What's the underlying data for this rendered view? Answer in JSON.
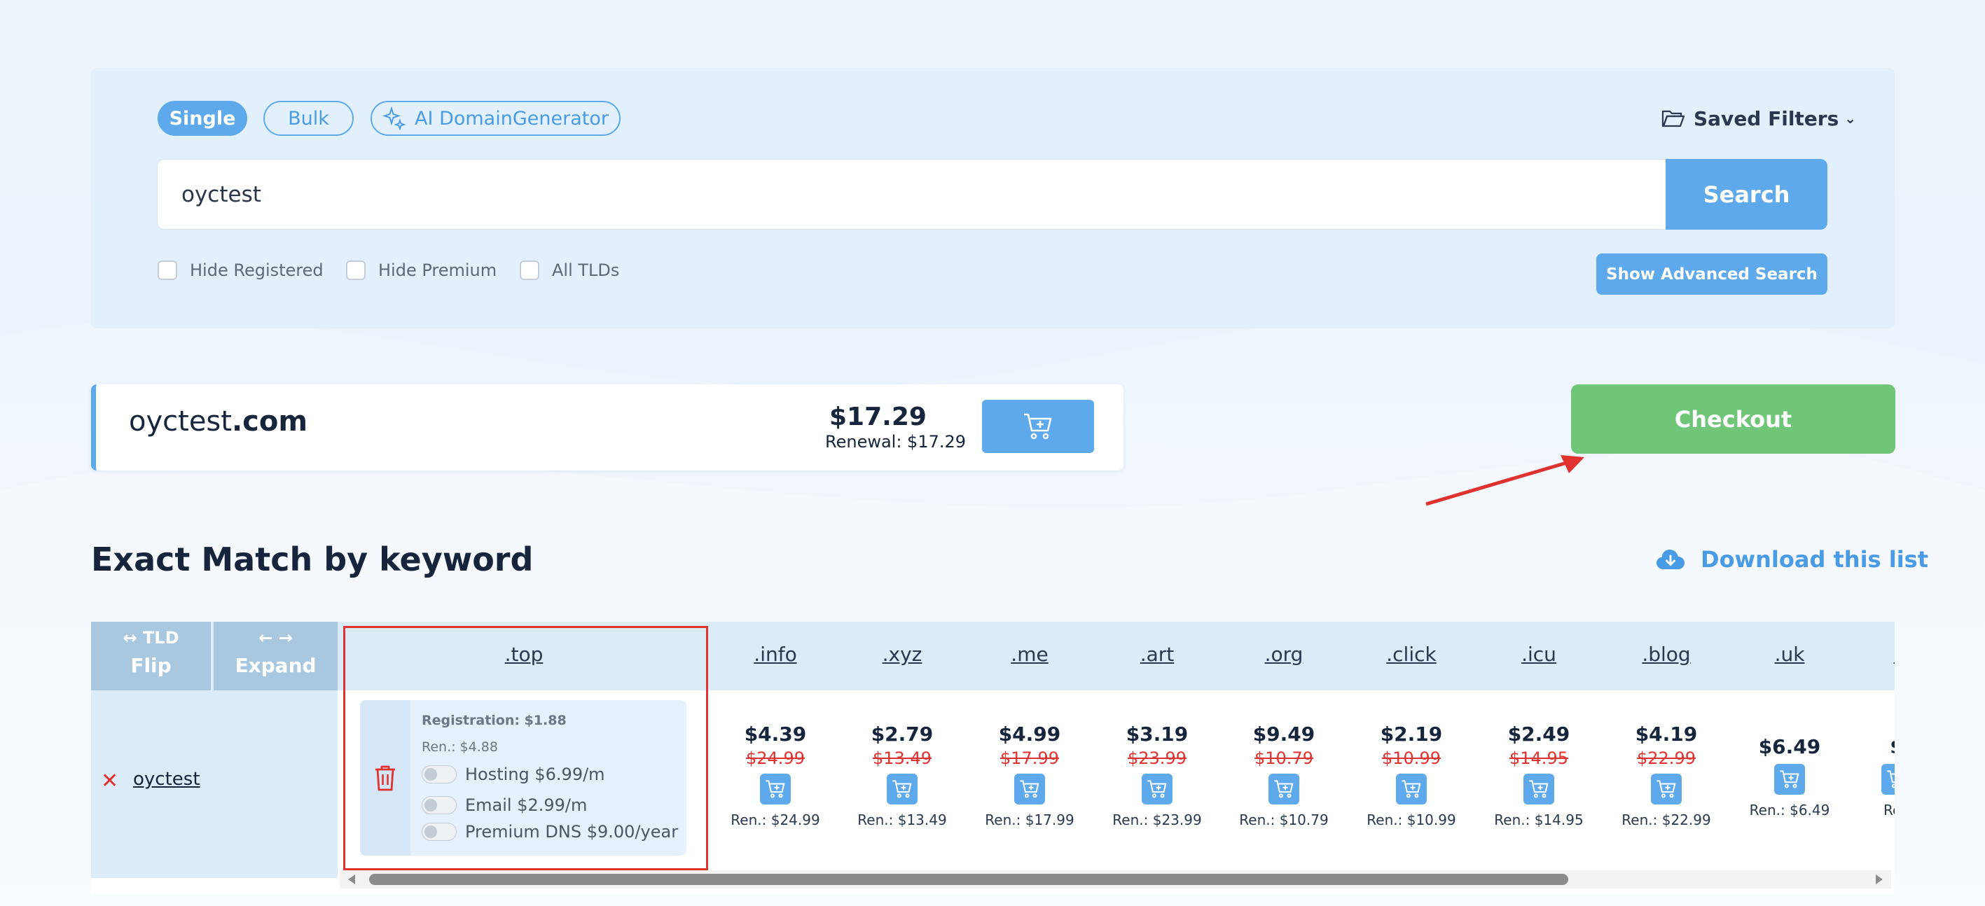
{
  "search": {
    "tabs": [
      {
        "label": "Single",
        "active": true
      },
      {
        "label": "Bulk",
        "active": false
      },
      {
        "label": "AI DomainGenerator",
        "active": false
      }
    ],
    "saved_filters_label": "Saved Filters",
    "query": "oyctest",
    "button_label": "Search",
    "filters": [
      "Hide Registered",
      "Hide Premium",
      "All TLDs"
    ],
    "advanced_button_label": "Show Advanced Search"
  },
  "primary_result": {
    "name": "oyctest",
    "tld": ".com",
    "price": "$17.29",
    "renewal": "Renewal: $17.29"
  },
  "checkout_label": "Checkout",
  "section": {
    "title": "Exact Match by keyword",
    "download_label": "Download this list"
  },
  "table": {
    "controls": [
      {
        "icon_text": "↔ TLD",
        "label": "Flip"
      },
      {
        "icon_text": "← →",
        "label": "Expand"
      }
    ],
    "keyword": "oyctest",
    "selected": {
      "tld": ".top",
      "registration": "Registration: $1.88",
      "renewal": "Ren.: $4.88",
      "options": [
        "Hosting $6.99/m",
        "Email $2.99/m",
        "Premium DNS $9.00/year"
      ]
    },
    "columns": [
      {
        "tld": ".info",
        "price": "$4.39",
        "old": "$24.99",
        "ren": "Ren.: $24.99"
      },
      {
        "tld": ".xyz",
        "price": "$2.79",
        "old": "$13.49",
        "ren": "Ren.: $13.49"
      },
      {
        "tld": ".me",
        "price": "$4.99",
        "old": "$17.99",
        "ren": "Ren.: $17.99"
      },
      {
        "tld": ".art",
        "price": "$3.19",
        "old": "$23.99",
        "ren": "Ren.: $23.99"
      },
      {
        "tld": ".org",
        "price": "$9.49",
        "old": "$10.79",
        "ren": "Ren.: $10.79"
      },
      {
        "tld": ".click",
        "price": "$2.19",
        "old": "$10.99",
        "ren": "Ren.: $10.99"
      },
      {
        "tld": ".icu",
        "price": "$2.49",
        "old": "$14.95",
        "ren": "Ren.: $14.95"
      },
      {
        "tld": ".blog",
        "price": "$4.19",
        "old": "$22.99",
        "ren": "Ren.: $22.99"
      },
      {
        "tld": ".uk",
        "price": "$6.49",
        "old": "",
        "ren": "Ren.: $6.49"
      },
      {
        "tld": ".",
        "price": "$",
        "old": "",
        "ren": "Ren"
      }
    ]
  },
  "colors": {
    "primary_blue": "#5ea9ec",
    "checkout_green": "#6fc679",
    "annotation_red": "#e0322f",
    "dark_text": "#16243c"
  }
}
